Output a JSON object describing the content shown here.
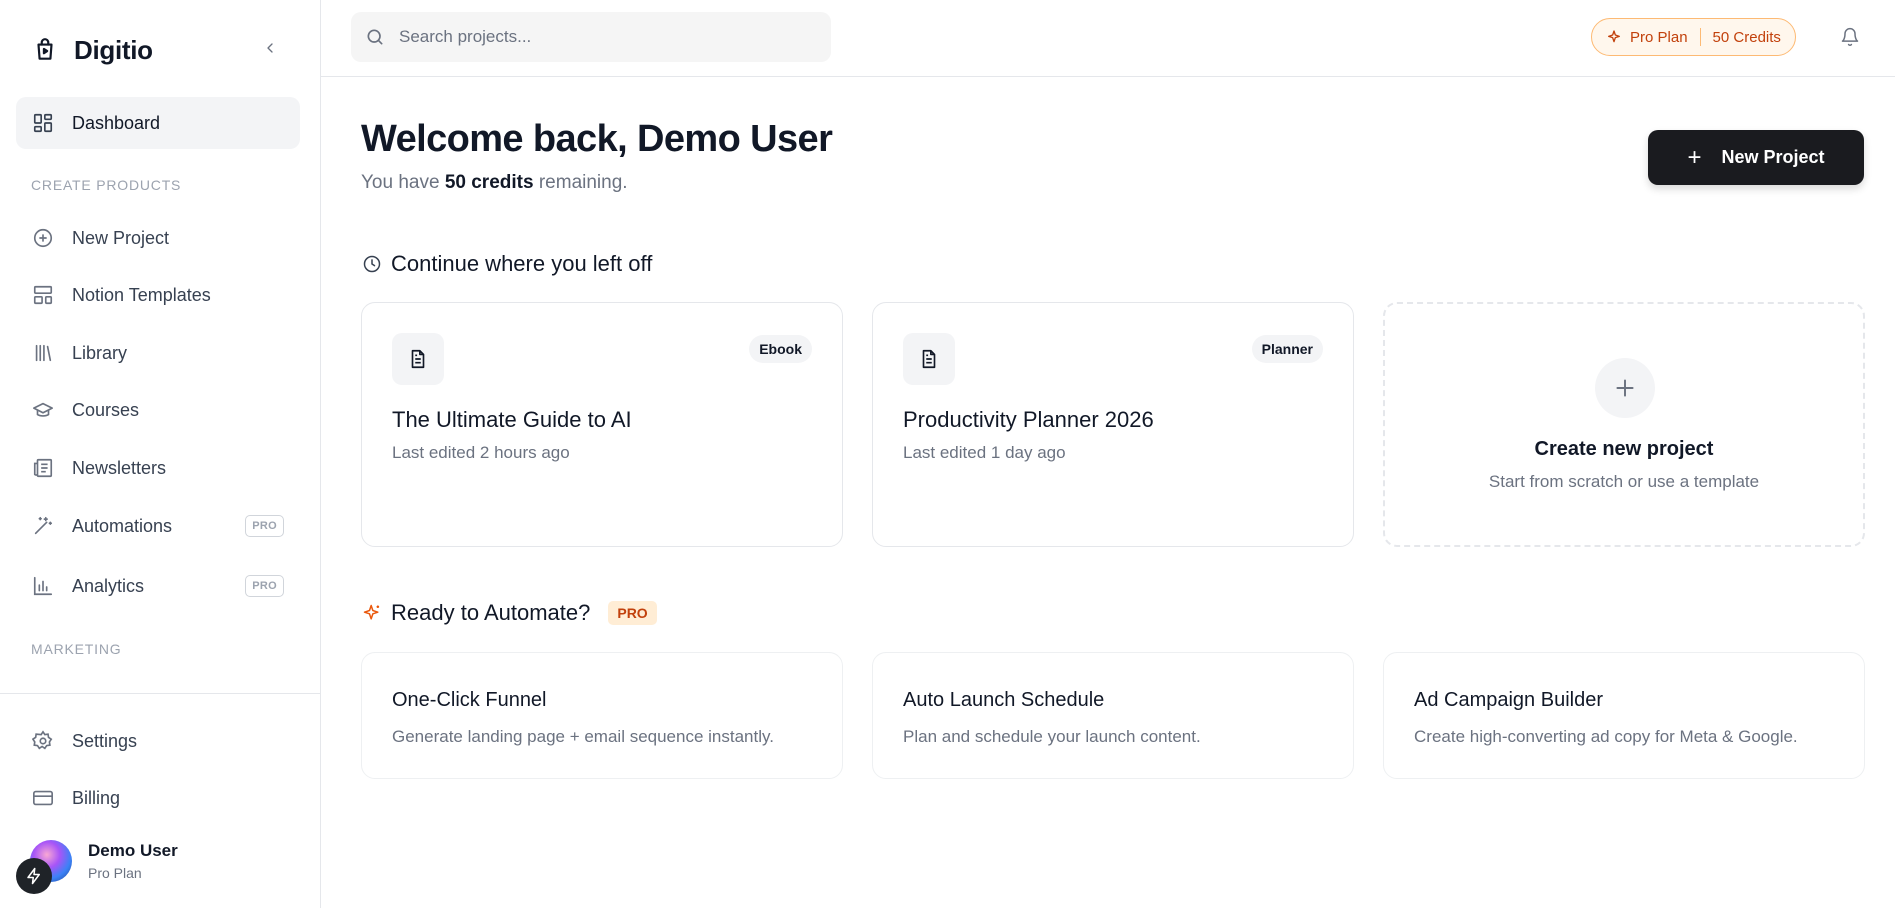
{
  "brand": {
    "name": "Digitio"
  },
  "sidebar": {
    "dashboard": {
      "label": "Dashboard",
      "icon": "dashboard-icon"
    },
    "section_create": "CREATE PRODUCTS",
    "items": [
      {
        "label": "New Project",
        "icon": "plus-circle-icon"
      },
      {
        "label": "Notion Templates",
        "icon": "layout-template-icon"
      },
      {
        "label": "Library",
        "icon": "library-icon"
      },
      {
        "label": "Courses",
        "icon": "graduation-cap-icon"
      },
      {
        "label": "Newsletters",
        "icon": "newspaper-icon"
      },
      {
        "label": "Automations",
        "icon": "magic-wand-icon",
        "badge": "PRO"
      },
      {
        "label": "Analytics",
        "icon": "bar-chart-icon",
        "badge": "PRO"
      }
    ],
    "section_marketing": "MARKETING",
    "settings": {
      "label": "Settings",
      "icon": "gear-icon"
    },
    "billing": {
      "label": "Billing",
      "icon": "credit-card-icon"
    }
  },
  "user": {
    "name": "Demo User",
    "plan": "Pro Plan"
  },
  "topbar": {
    "search_placeholder": "Search projects...",
    "plan_label": "Pro Plan",
    "credits_label": "50 Credits"
  },
  "main": {
    "welcome": "Welcome back, Demo User",
    "sub_prefix": "You have ",
    "sub_credits": "50 credits",
    "sub_suffix": " remaining.",
    "new_project_label": "New Project",
    "continue_title": "Continue where you left off",
    "projects": [
      {
        "title": "The Ultimate Guide to AI",
        "meta": "Last edited 2 hours ago",
        "tag": "Ebook"
      },
      {
        "title": "Productivity Planner 2026",
        "meta": "Last edited 1 day ago",
        "tag": "Planner"
      }
    ],
    "create_card": {
      "title": "Create new project",
      "meta": "Start from scratch or use a template"
    },
    "automate_title": "Ready to Automate?",
    "automate_badge": "PRO",
    "automations": [
      {
        "title": "One-Click Funnel",
        "desc": "Generate landing page + email sequence instantly."
      },
      {
        "title": "Auto Launch Schedule",
        "desc": "Plan and schedule your launch content."
      },
      {
        "title": "Ad Campaign Builder",
        "desc": "Create high-converting ad copy for Meta & Google."
      }
    ]
  },
  "colors": {
    "accent": "#c2410c",
    "accent_bg": "#fff7ed",
    "primary_button": "#1a1b1f"
  }
}
